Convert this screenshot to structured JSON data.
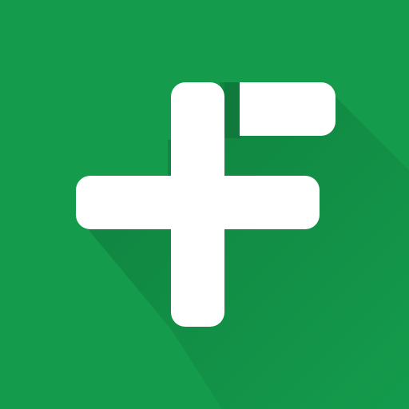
{
  "icon": {
    "name": "plus-f-logo-icon",
    "colors": {
      "background": "#149b4c",
      "shadow": "#0b6b35",
      "glyph": "#ffffff",
      "notch": "#0f7a3c"
    }
  }
}
